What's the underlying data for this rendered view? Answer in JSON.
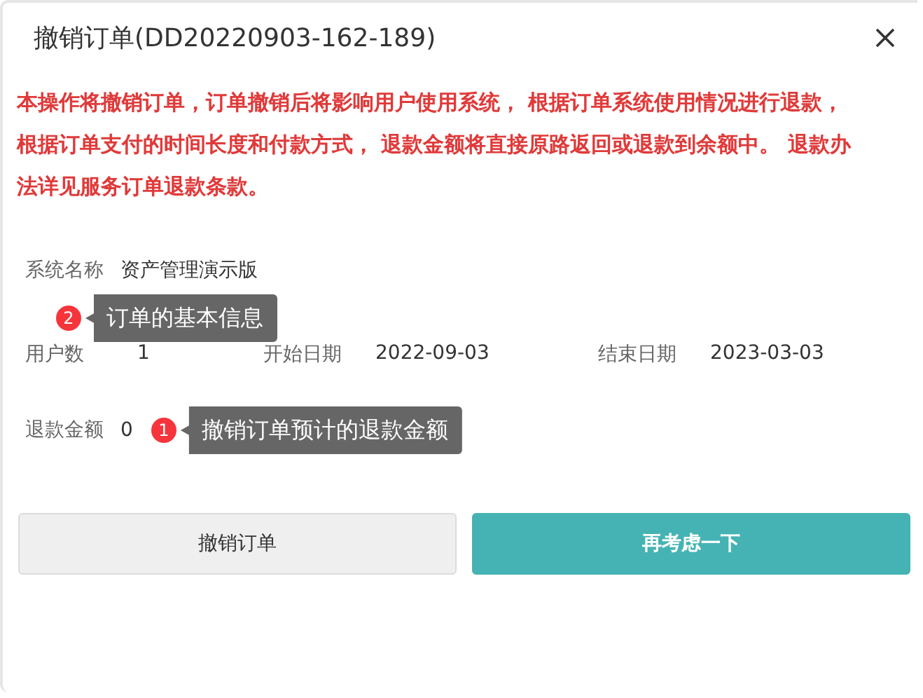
{
  "dialog": {
    "title": "撤销订单(DD20220903-162-189)"
  },
  "warning": "本操作将撤销订单，订单撤销后将影响用户使用系统， 根据订单系统使用情况进行退款，根据订单支付的时间长度和付款方式， 退款金额将直接原路返回或退款到余额中。 退款办法详见服务订单退款条款。",
  "system": {
    "label": "系统名称",
    "value": "资产管理演示版"
  },
  "basic_hint": {
    "number": "2",
    "text": "订单的基本信息"
  },
  "fields": [
    {
      "label": "用户数",
      "value": "1"
    },
    {
      "label": "开始日期",
      "value": "2022-09-03"
    },
    {
      "label": "结束日期",
      "value": "2023-03-03"
    }
  ],
  "refund": {
    "label": "退款金额",
    "value": "0",
    "hint": {
      "number": "1",
      "text": "撤销订单预计的退款金额"
    }
  },
  "buttons": [
    {
      "label": "撤销订单",
      "kind": "secondary"
    },
    {
      "label": "再考虑一下",
      "kind": "primary"
    }
  ]
}
